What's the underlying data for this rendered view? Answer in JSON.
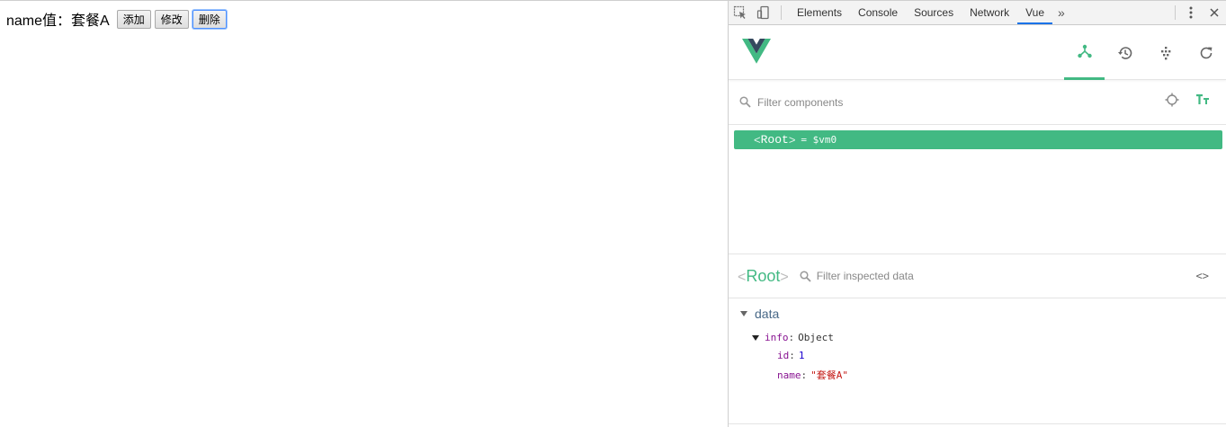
{
  "page": {
    "label": "name值：套餐A",
    "buttons": {
      "add": "添加",
      "edit": "修改",
      "delete": "删除"
    }
  },
  "devtools": {
    "tabs": [
      "Elements",
      "Console",
      "Sources",
      "Network",
      "Vue"
    ],
    "active_tab": "Vue",
    "more": "»",
    "icons": {
      "inspect": "inspect-element-icon",
      "device": "device-toolbar-icon",
      "menu": "kebab-menu-icon",
      "close": "close-icon"
    }
  },
  "vue": {
    "nav": [
      "components-icon",
      "history-icon",
      "vuex-icon",
      "refresh-icon"
    ],
    "accent": "#42b983",
    "filter_components_placeholder": "Filter components",
    "tree": {
      "root_open": "<",
      "root_name": "Root",
      "root_close": ">",
      "vm": "= $vm0"
    },
    "inspector": {
      "open": "<",
      "name": "Root",
      "close": ">",
      "filter_placeholder": "Filter inspected data",
      "code_toggle": "<>"
    },
    "data": {
      "heading": "data",
      "info_key": "info",
      "info_value": "Object",
      "id_key": "id",
      "id_value": "1",
      "name_key": "name",
      "name_value": "\"套餐A\""
    }
  }
}
